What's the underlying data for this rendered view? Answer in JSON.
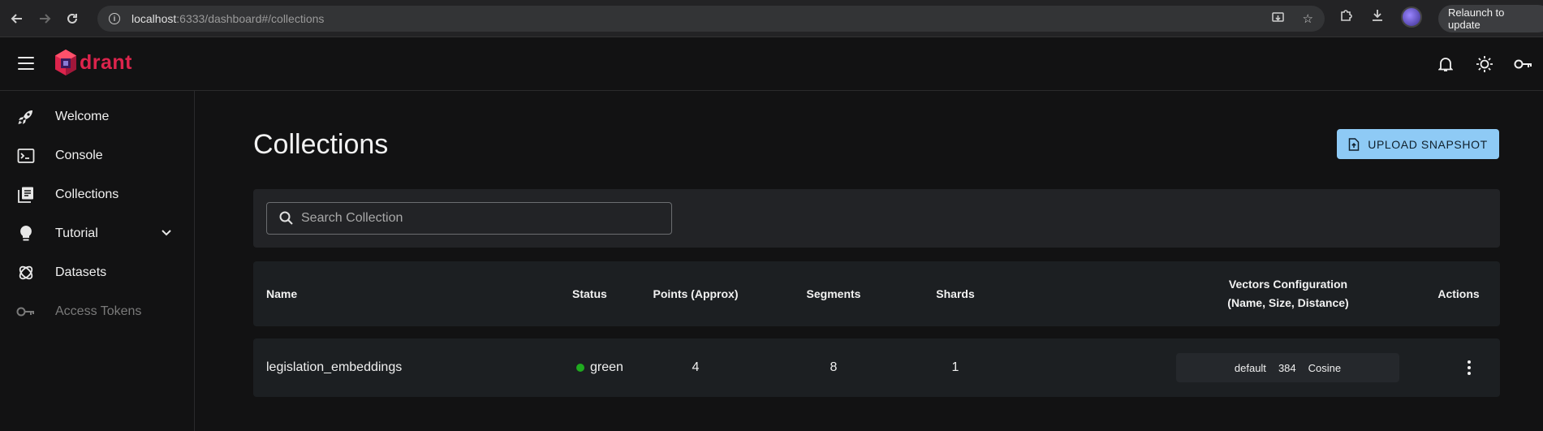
{
  "browser": {
    "url_host": "localhost",
    "url_rest": ":6333/dashboard#/collections",
    "relaunch_label": "Relaunch to update"
  },
  "app": {
    "brand": "drant",
    "brand_color": "#dc244c"
  },
  "sidebar": {
    "items": [
      {
        "label": "Welcome",
        "icon": "rocket-icon"
      },
      {
        "label": "Console",
        "icon": "terminal-icon"
      },
      {
        "label": "Collections",
        "icon": "library-icon"
      },
      {
        "label": "Tutorial",
        "icon": "lightbulb-icon"
      },
      {
        "label": "Datasets",
        "icon": "datasets-icon"
      },
      {
        "label": "Access Tokens",
        "icon": "key-icon"
      }
    ]
  },
  "main": {
    "title": "Collections",
    "upload_label": "UPLOAD SNAPSHOT",
    "accent": "#8ecaf5",
    "search": {
      "placeholder": "Search Collection",
      "value": ""
    },
    "table": {
      "headers": {
        "name": "Name",
        "status": "Status",
        "points": "Points (Approx)",
        "segments": "Segments",
        "shards": "Shards",
        "vectors_line1": "Vectors Configuration",
        "vectors_line2": "(Name, Size, Distance)",
        "actions": "Actions"
      },
      "rows": [
        {
          "name": "legislation_embeddings",
          "status": "green",
          "status_color": "#1faa1f",
          "points": "4",
          "segments": "8",
          "shards": "1",
          "vector_name": "default",
          "vector_size": "384",
          "vector_distance": "Cosine"
        }
      ]
    }
  }
}
